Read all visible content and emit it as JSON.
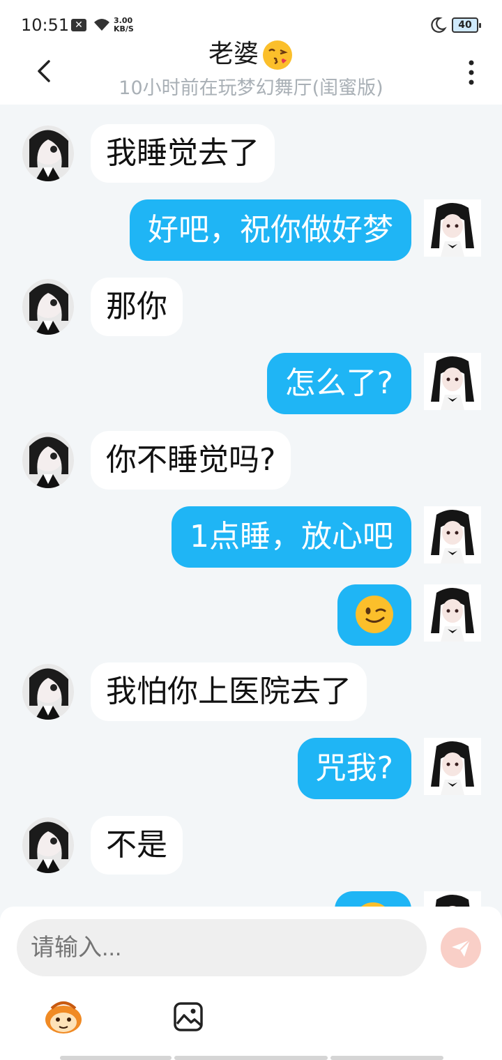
{
  "status": {
    "time": "10:51",
    "speed_value": "3.00",
    "speed_unit": "KB/S",
    "battery": "40"
  },
  "header": {
    "title": "老婆",
    "subtitle": "10小时前在玩梦幻舞厅(闺蜜版)"
  },
  "messages": [
    {
      "from": "them",
      "text": "我睡觉去了"
    },
    {
      "from": "me",
      "text": "好吧，祝你做好梦"
    },
    {
      "from": "them",
      "text": "那你"
    },
    {
      "from": "me",
      "text": "怎么了?"
    },
    {
      "from": "them",
      "text": "你不睡觉吗?"
    },
    {
      "from": "me",
      "text": "1点睡，放心吧"
    },
    {
      "from": "me",
      "emoji": "winking-face"
    },
    {
      "from": "them",
      "text": "我怕你上医院去了"
    },
    {
      "from": "me",
      "text": "咒我?"
    },
    {
      "from": "them",
      "text": "不是"
    },
    {
      "from": "me",
      "emoji": "partial-emoji"
    }
  ],
  "composer": {
    "placeholder": "请输入..."
  },
  "colors": {
    "accent_bubble": "#1fb5f5",
    "incoming_bubble": "#ffffff",
    "background": "#f3f6f8",
    "send_button": "#f9cfc7"
  },
  "icons": [
    "back-icon",
    "more-icon",
    "send-icon",
    "mascot-icon",
    "image-icon",
    "wifi-icon",
    "moon-icon"
  ]
}
